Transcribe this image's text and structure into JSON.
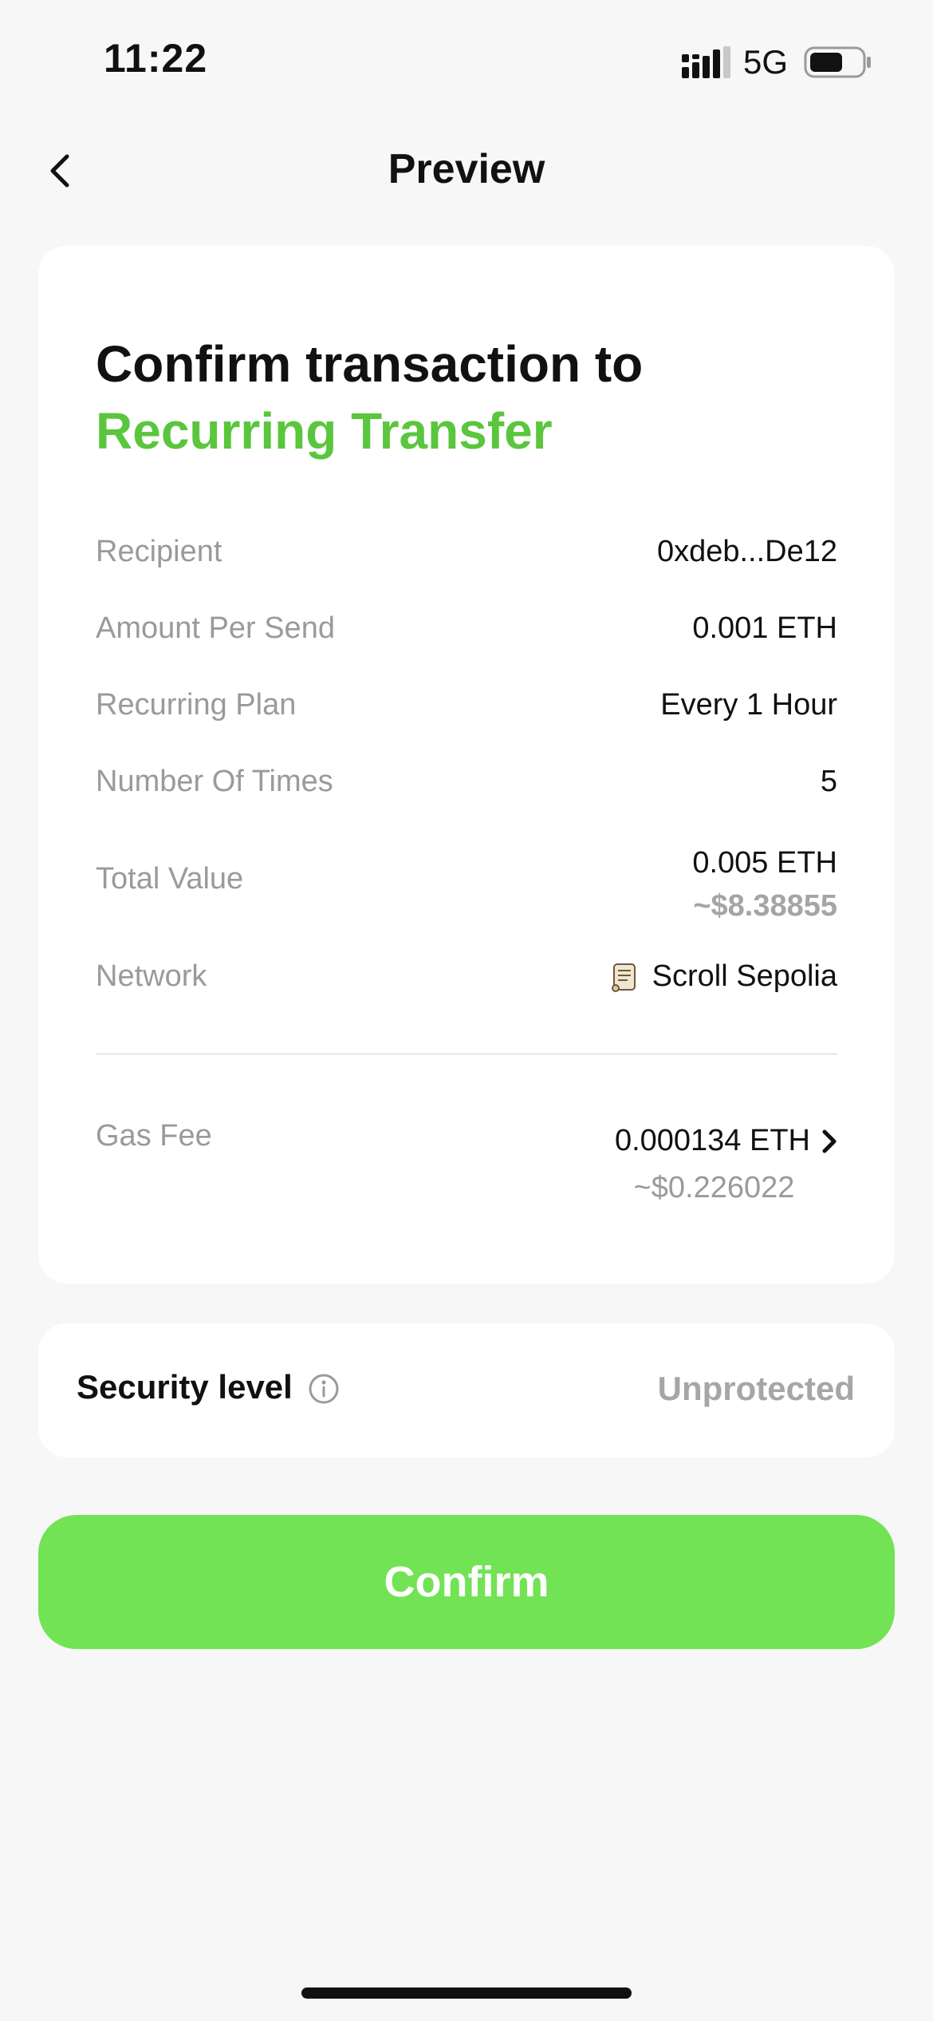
{
  "status_bar": {
    "time": "11:22",
    "network": "5G",
    "icons": [
      "signal-icon",
      "battery-icon"
    ]
  },
  "header": {
    "title": "Preview",
    "back_icon": "chevron-left-icon"
  },
  "card": {
    "title_line1": "Confirm transaction to",
    "title_line2": "Recurring Transfer",
    "accent_color": "#5ac63d",
    "rows": {
      "recipient": {
        "label": "Recipient",
        "value": "0xdeb...De12"
      },
      "amount_per_send": {
        "label": "Amount Per Send",
        "value": "0.001 ETH"
      },
      "recurring_plan": {
        "label": "Recurring Plan",
        "value": "Every 1 Hour"
      },
      "number_of_times": {
        "label": "Number Of Times",
        "value": "5"
      },
      "total_value": {
        "label": "Total Value",
        "value": "0.005 ETH",
        "sub_value": "~$8.38855"
      },
      "network": {
        "label": "Network",
        "value": "Scroll Sepolia",
        "icon": "scroll-icon"
      },
      "gas_fee": {
        "label": "Gas Fee",
        "value": "0.000134 ETH",
        "sub_value": "~$0.226022",
        "icon": "chevron-right-icon"
      }
    }
  },
  "security": {
    "label": "Security level",
    "value": "Unprotected",
    "icon": "info-icon"
  },
  "confirm_button": {
    "label": "Confirm",
    "color": "#72e354"
  }
}
